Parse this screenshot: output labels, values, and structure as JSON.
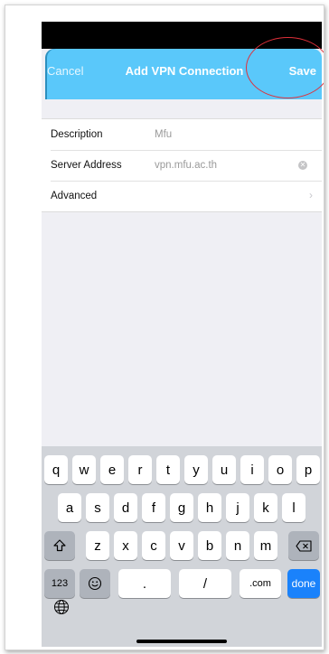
{
  "nav": {
    "cancel": "Cancel",
    "title": "Add VPN Connection",
    "save": "Save"
  },
  "form": {
    "rows": [
      {
        "label": "Description",
        "value": "Mfu"
      },
      {
        "label": "Server Address",
        "value": "vpn.mfu.ac.th",
        "icon": "clear-icon"
      },
      {
        "label": "Advanced",
        "value": "",
        "icon": "chevron-right-icon"
      }
    ]
  },
  "keyboard": {
    "row1": [
      "q",
      "w",
      "e",
      "r",
      "t",
      "y",
      "u",
      "i",
      "o",
      "p"
    ],
    "row2": [
      "a",
      "s",
      "d",
      "f",
      "g",
      "h",
      "j",
      "k",
      "l"
    ],
    "row3": [
      "z",
      "x",
      "c",
      "v",
      "b",
      "n",
      "m"
    ],
    "numbers_label": "123",
    "period": ".",
    "slash": "/",
    "dotcom": ".com",
    "done": "done",
    "shift_icon": "shift-icon",
    "delete_icon": "delete-icon",
    "emoji_icon": "emoji-icon",
    "globe_icon": "globe-icon"
  },
  "colors": {
    "nav_bar": "#5ac8fa",
    "done_key": "#1a82fb",
    "highlight_circle": "#e0303a"
  }
}
